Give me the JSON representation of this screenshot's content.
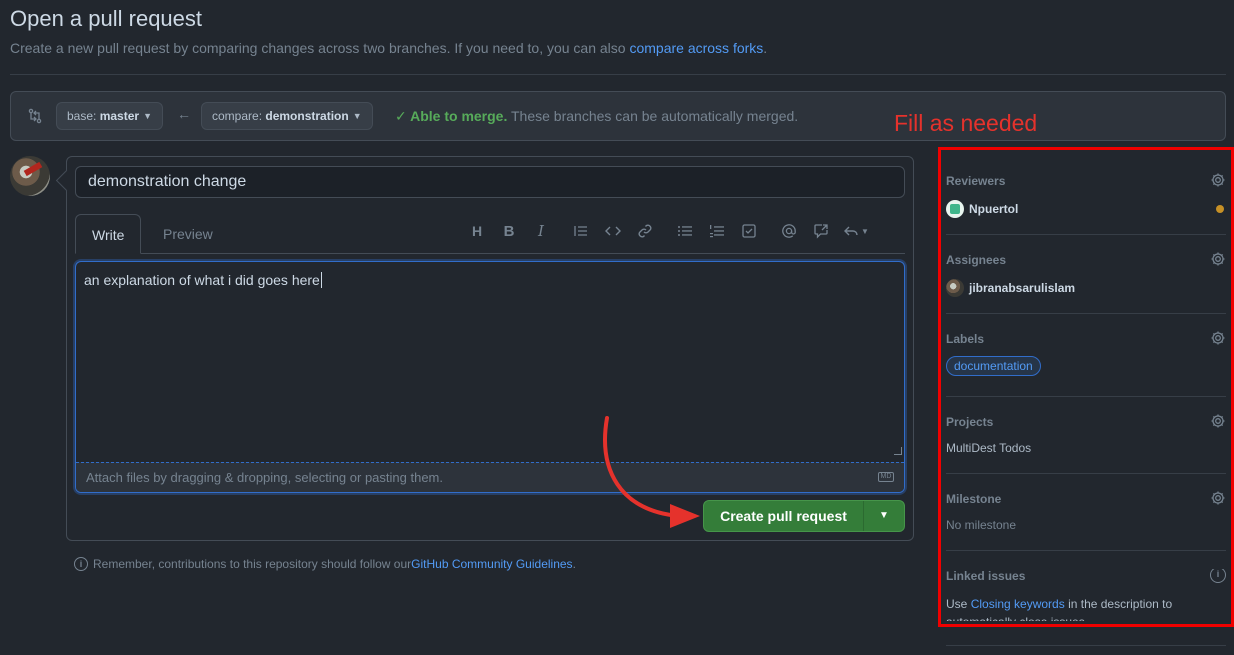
{
  "header": {
    "title": "Open a pull request",
    "subtitle": "Create a new pull request by comparing changes across two branches. If you need to, you can also ",
    "subtitle_link": "compare across forks",
    "subtitle_end": "."
  },
  "range": {
    "base_prefix": "base: ",
    "base_branch": "master",
    "compare_prefix": "compare: ",
    "compare_branch": "demonstration",
    "merge_ok": "Able to merge.",
    "merge_text": " These branches can be automatically merged."
  },
  "annotation": "Fill as needed",
  "editor": {
    "title_value": "demonstration change",
    "tab_write": "Write",
    "tab_preview": "Preview",
    "body_text": "an explanation of what i did goes here",
    "attach_text": "Attach files by dragging & dropping, selecting or pasting them.",
    "md_badge": "MD",
    "toolbar": [
      "heading-icon",
      "bold-icon",
      "italic-icon",
      "quote-icon",
      "code-icon",
      "link-icon",
      "unordered-list-icon",
      "ordered-list-icon",
      "task-list-icon",
      "mention-icon",
      "reference-icon",
      "reply-icon"
    ]
  },
  "actions": {
    "create_label": "Create pull request"
  },
  "guidelines": {
    "text": "Remember, contributions to this repository should follow our ",
    "link": "GitHub Community Guidelines",
    "end": "."
  },
  "sidebar": {
    "reviewers": {
      "heading": "Reviewers",
      "value": "Npuertol"
    },
    "assignees": {
      "heading": "Assignees",
      "value": "jibranabsarulislam"
    },
    "labels": {
      "heading": "Labels",
      "value": "documentation"
    },
    "projects": {
      "heading": "Projects",
      "value": "MultiDest Todos"
    },
    "milestone": {
      "heading": "Milestone",
      "value": "No milestone"
    },
    "linked_issues": {
      "heading": "Linked issues",
      "pre": "Use ",
      "link": "Closing keywords",
      "post": " in the description to automatically close issues"
    }
  },
  "colors": {
    "background": "#22272e",
    "accent_green": "#347d39",
    "link_blue": "#539bf5",
    "annotation_red": "#e5322c"
  }
}
